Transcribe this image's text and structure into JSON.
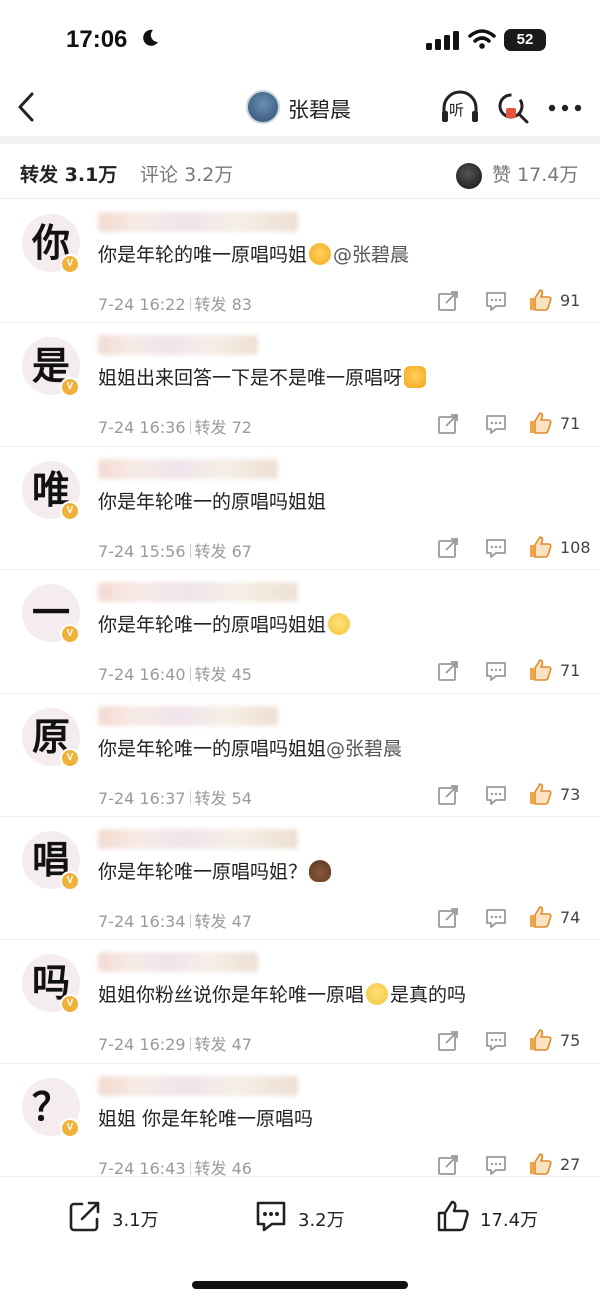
{
  "status": {
    "time": "17:06",
    "battery": "52"
  },
  "nav": {
    "user_name": "张碧晨",
    "listen_label": "听"
  },
  "tabs": {
    "repost": {
      "label": "转发",
      "count": "3.1万"
    },
    "comment": {
      "label": "评论",
      "count": "3.2万"
    },
    "like": {
      "label": "赞",
      "count": "17.4万"
    }
  },
  "repost_label": "转发",
  "items": [
    {
      "avatar_char": "你",
      "text": "你是年轮的唯一原唱吗姐",
      "emoji": "lick",
      "mention": "@张碧晨",
      "time": "7-24 16:22",
      "reposts": "83",
      "likes": "91"
    },
    {
      "avatar_char": "是",
      "text": "姐姐出来回答一下是不是唯一原唱呀",
      "emoji": "money",
      "mention": "",
      "time": "7-24 16:36",
      "reposts": "72",
      "likes": "71"
    },
    {
      "avatar_char": "唯",
      "text": "你是年轮唯一的原唱吗姐姐",
      "emoji": "",
      "mention": "",
      "time": "7-24 15:56",
      "reposts": "67",
      "likes": "108"
    },
    {
      "avatar_char": "一",
      "text": "你是年轮唯一的原唱吗姐姐",
      "emoji": "sad",
      "mention": "",
      "time": "7-24 16:40",
      "reposts": "45",
      "likes": "71"
    },
    {
      "avatar_char": "原",
      "text": "你是年轮唯一的原唱吗姐姐",
      "emoji": "",
      "mention": "@张碧晨",
      "time": "7-24 16:37",
      "reposts": "54",
      "likes": "73"
    },
    {
      "avatar_char": "唱",
      "text": "你是年轮唯一原唱吗姐？",
      "emoji": "poop",
      "mention": "",
      "time": "7-24 16:34",
      "reposts": "47",
      "likes": "74"
    },
    {
      "avatar_char": "吗",
      "text": "姐姐你粉丝说你是年轮唯一原唱",
      "emoji": "sad",
      "text_after": "是真的吗",
      "mention": "",
      "time": "7-24 16:29",
      "reposts": "47",
      "likes": "75"
    },
    {
      "avatar_char": "？",
      "text": "姐姐 你是年轮唯一原唱吗",
      "emoji": "",
      "mention": "",
      "time": "7-24 16:43",
      "reposts": "46",
      "likes": "27"
    }
  ],
  "bottom": {
    "repost_count": "3.1万",
    "comment_count": "3.2万",
    "like_count": "17.4万"
  },
  "colors": {
    "verified_badge": "#f0b13a",
    "avatar_bg": "#f4ecef",
    "meta_text": "#9a9a9a"
  }
}
